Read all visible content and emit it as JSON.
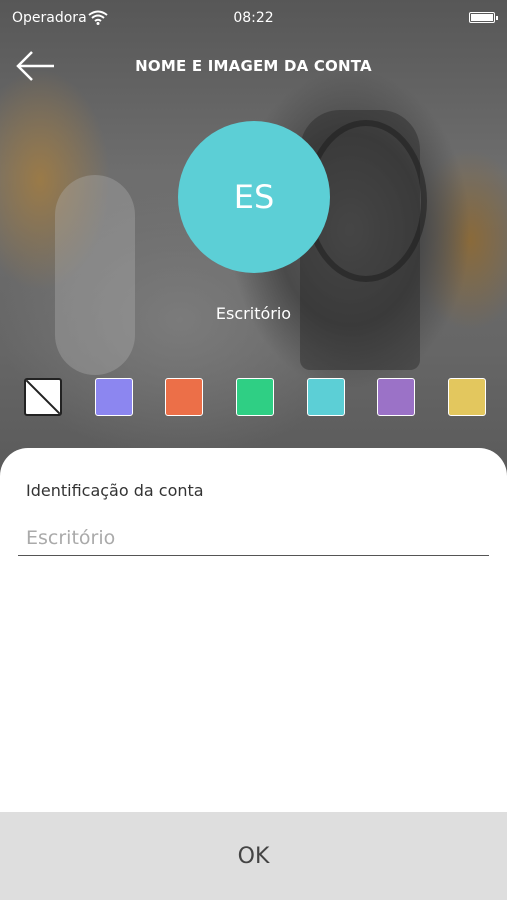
{
  "status_bar": {
    "carrier": "Operadora",
    "time": "08:22"
  },
  "header": {
    "title": "NOME E IMAGEM DA CONTA",
    "back_icon": "arrow-left-icon"
  },
  "avatar": {
    "initials": "ES",
    "color": "#5ccfd6",
    "name": "Escritório"
  },
  "colors": {
    "swatches": [
      {
        "name": "none",
        "color": "#ffffff"
      },
      {
        "name": "blue",
        "color": "#8c86f0"
      },
      {
        "name": "orange",
        "color": "#ec6f48"
      },
      {
        "name": "green",
        "color": "#2fcf84"
      },
      {
        "name": "cyan",
        "color": "#5ccfd6"
      },
      {
        "name": "purple",
        "color": "#9b72c7"
      },
      {
        "name": "yellow",
        "color": "#e3c75e"
      }
    ]
  },
  "form": {
    "label": "Identificação da conta",
    "placeholder": "Escritório",
    "value": ""
  },
  "footer": {
    "ok_label": "OK"
  }
}
